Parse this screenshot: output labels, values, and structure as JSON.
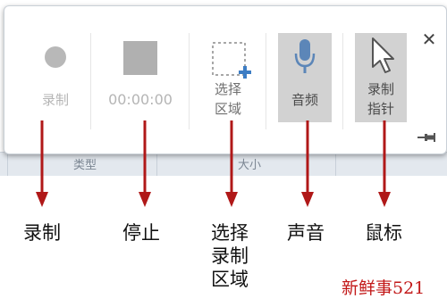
{
  "background_panel": {
    "col1_label": "类型",
    "col2_label": "大小"
  },
  "toolbar": {
    "record": {
      "label": "录制",
      "icon": "record-dot-icon",
      "state": "disabled"
    },
    "stop": {
      "label": "00:00:00",
      "icon": "stop-square-icon",
      "state": "disabled"
    },
    "select_area": {
      "label_line1": "选择",
      "label_line2": "区域",
      "icon": "select-area-plus-icon"
    },
    "audio": {
      "label": "音频",
      "icon": "microphone-icon",
      "state": "active"
    },
    "pointer": {
      "label_line1": "录制",
      "label_line2": "指针",
      "icon": "cursor-pointer-icon",
      "state": "active"
    },
    "close_icon": "close-icon",
    "pin_icon": "pin-icon"
  },
  "callouts": {
    "record": "录制",
    "stop": "停止",
    "select_area": [
      "选择",
      "录制",
      "区域"
    ],
    "audio": "声音",
    "pointer": "鼠标"
  },
  "watermark": "新鲜事521",
  "colors": {
    "arrow": "#b01818",
    "watermark": "#c21717",
    "active_bg": "#d2d2d2",
    "mic_blue": "#5c86b8"
  }
}
